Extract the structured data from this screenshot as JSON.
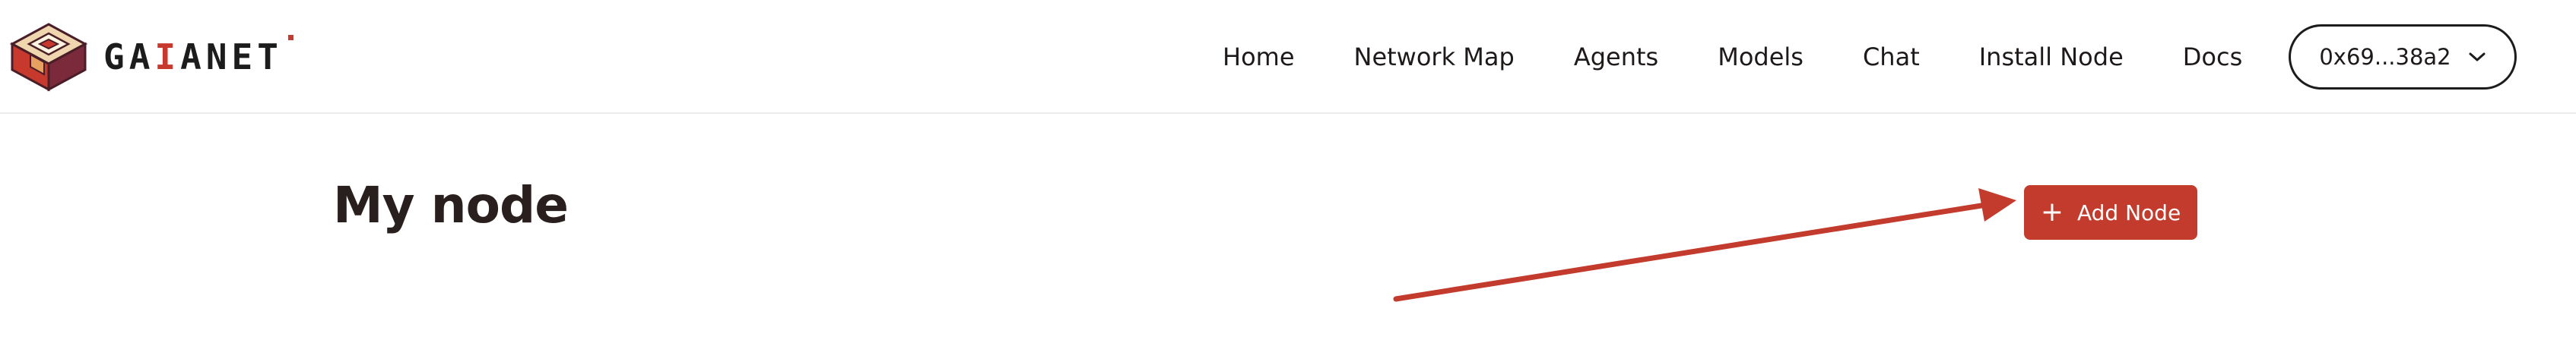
{
  "brand": {
    "wordmark_letters": [
      {
        "char": "G",
        "accent": false
      },
      {
        "char": "A",
        "accent": false
      },
      {
        "char": "I",
        "accent": true
      },
      {
        "char": "A",
        "accent": false
      },
      {
        "char": "N",
        "accent": false
      },
      {
        "char": "E",
        "accent": false
      },
      {
        "char": "T",
        "accent": false
      }
    ],
    "logo_icon": "gaianet-cube-logo-icon"
  },
  "nav": {
    "items": [
      {
        "label": "Home"
      },
      {
        "label": "Network Map"
      },
      {
        "label": "Agents"
      },
      {
        "label": "Models"
      },
      {
        "label": "Chat"
      },
      {
        "label": "Install Node"
      },
      {
        "label": "Docs"
      }
    ]
  },
  "wallet": {
    "address": "0x69...38a2",
    "icon": "chevron-down-icon"
  },
  "main": {
    "title": "My node",
    "add_button": {
      "label": "Add Node",
      "icon": "plus-icon"
    }
  },
  "annotation": {
    "icon": "arrow-pointer-annotation",
    "color": "#c23b2c"
  },
  "colors": {
    "accent": "#c23b2c",
    "text": "#1f1a1a",
    "border": "#ededed"
  }
}
